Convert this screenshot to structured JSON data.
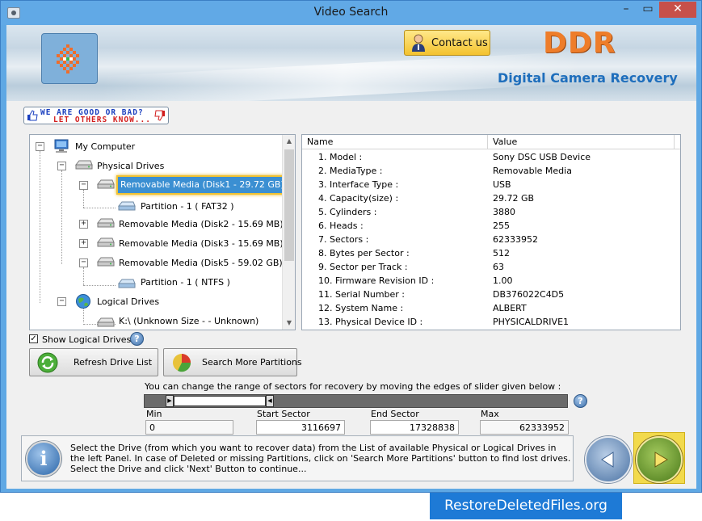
{
  "window": {
    "title": "Video Search",
    "min": "–",
    "max": "▭",
    "close": "✕"
  },
  "header": {
    "contact_label": "Contact us",
    "brand": "DDR",
    "subtitle": "Digital Camera Recovery"
  },
  "feedback": {
    "line1": "WE ARE GOOD OR BAD?",
    "line2": "LET OTHERS KNOW..."
  },
  "tree": {
    "root": "My Computer",
    "physical": "Physical Drives",
    "items": [
      {
        "label": "Removable Media (Disk1 - 29.72 GB)",
        "selected": true
      },
      {
        "label": "Partition - 1 ( FAT32 )"
      },
      {
        "label": "Removable Media (Disk2 - 15.69 MB)"
      },
      {
        "label": "Removable Media (Disk3 - 15.69 MB)"
      },
      {
        "label": "Removable Media (Disk5 - 59.02 GB)"
      },
      {
        "label": "Partition - 1 ( NTFS )"
      }
    ],
    "logical": "Logical Drives",
    "logical_items": [
      {
        "label": "K:\\ (Unknown Size  -  - Unknown)"
      }
    ]
  },
  "properties": {
    "headers": {
      "name": "Name",
      "value": "Value"
    },
    "rows": [
      {
        "name": "1. Model :",
        "value": "Sony DSC USB Device"
      },
      {
        "name": "2. MediaType :",
        "value": "Removable Media"
      },
      {
        "name": "3. Interface Type :",
        "value": "USB"
      },
      {
        "name": "4. Capacity(size) :",
        "value": "29.72 GB"
      },
      {
        "name": "5. Cylinders :",
        "value": "3880"
      },
      {
        "name": "6. Heads :",
        "value": "255"
      },
      {
        "name": "7. Sectors :",
        "value": "62333952"
      },
      {
        "name": "8. Bytes per Sector :",
        "value": "512"
      },
      {
        "name": "9. Sector per Track :",
        "value": "63"
      },
      {
        "name": "10. Firmware Revision ID :",
        "value": "1.00"
      },
      {
        "name": "11. Serial Number :",
        "value": "DB376022C4D5"
      },
      {
        "name": "12. System Name :",
        "value": "ALBERT"
      },
      {
        "name": "13. Physical Device ID :",
        "value": "PHYSICALDRIVE1"
      }
    ]
  },
  "controls": {
    "show_logical": "Show Logical Drives",
    "show_logical_checked": true,
    "refresh": "Refresh Drive List",
    "search_more": "Search More Partitions",
    "help": "?"
  },
  "sectors": {
    "hint": "You can change the range of sectors for recovery by moving the edges of slider given below :",
    "min_label": "Min",
    "min_value": "0",
    "start_label": "Start Sector",
    "start_value": "3116697",
    "end_label": "End Sector",
    "end_value": "17328838",
    "max_label": "Max",
    "max_value": "62333952"
  },
  "info": {
    "icon": "i",
    "text": "Select the Drive (from which you want to recover data) from the List of available Physical or Logical Drives in the left Panel. In case of Deleted or missing Partitions, click on 'Search More Partitions' button to find lost drives. Select the Drive and click 'Next' Button to continue..."
  },
  "footer": {
    "site": "RestoreDeletedFiles.org"
  },
  "colors": {
    "accent": "#1e7ad6",
    "brand": "#ee7d2a",
    "subtitle": "#1e6ebc",
    "selection": "#3b8fd2"
  }
}
